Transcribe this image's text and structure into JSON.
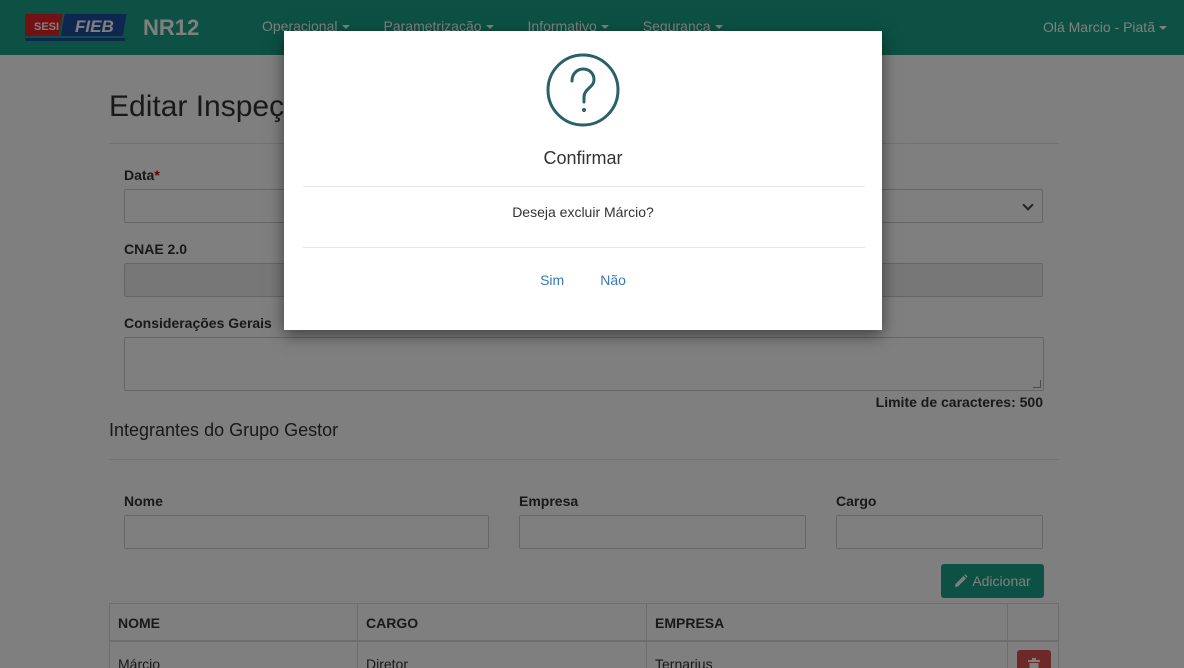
{
  "navbar": {
    "logo_text": "SESI FIEB",
    "brand": "NR12",
    "menu": [
      {
        "label": "Operacional"
      },
      {
        "label": "Parametrização"
      },
      {
        "label": "Informativo"
      },
      {
        "label": "Segurança"
      }
    ],
    "user_greeting": "Olá Marcio - Piatã"
  },
  "page": {
    "title": "Editar Inspeção",
    "fields": {
      "data_label": "Data",
      "data_required": "*",
      "cnae_label": "CNAE 2.0",
      "consideracoes_label": "Considerações Gerais",
      "char_limit": "Limite de caracteres: 500"
    },
    "grupo_gestor": {
      "section_title": "Integrantes do Grupo Gestor",
      "nome_label": "Nome",
      "empresa_label": "Empresa",
      "cargo_label": "Cargo",
      "add_button": "Adicionar"
    },
    "table": {
      "headers": [
        "NOME",
        "CARGO",
        "EMPRESA"
      ],
      "rows": [
        {
          "nome": "Márcio",
          "cargo": "Diretor",
          "empresa": "Ternarius"
        }
      ]
    }
  },
  "modal": {
    "icon": "question-circle-icon",
    "title": "Confirmar",
    "message": "Deseja excluir Márcio?",
    "confirm_label": "Sim",
    "cancel_label": "Não"
  },
  "colors": {
    "navbar": "#18a386",
    "danger": "#d9534f",
    "icon_teal": "#2a5f6b",
    "link": "#337ab7"
  }
}
